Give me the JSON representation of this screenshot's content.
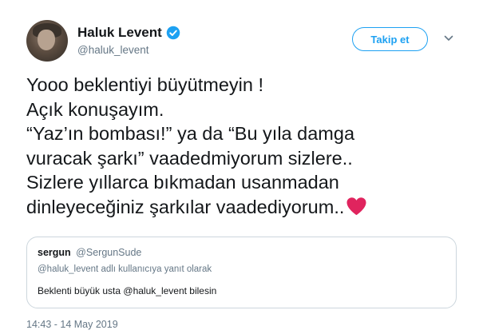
{
  "author": {
    "display_name": "Haluk Levent",
    "handle": "@haluk_levent",
    "verified": true,
    "avatar_icon": "profile-photo"
  },
  "actions": {
    "follow_label": "Takip et",
    "more_icon": "chevron-down-icon"
  },
  "tweet": {
    "lines": [
      "Yooo beklentiyi büyütmeyin !",
      "Açık konuşayım.",
      "“Yaz’ın bombası!” ya da “Bu yıla damga",
      "vuracak şarkı” vaadedmiyorum sizlere..",
      "Sizlere yıllarca bıkmadan usanmadan",
      "dinleyeceğiniz şarkılar vaadediyorum.."
    ],
    "emoji": "heart-icon",
    "heart_color": "#e0245e"
  },
  "quote": {
    "name": "sergun",
    "handle": "@SergunSude",
    "reply_context": "@haluk_levent adlı kullanıcıya yanıt olarak",
    "text": "Beklenti büyük usta @haluk_levent bilesin"
  },
  "timestamp": "14:43 - 14 May 2019",
  "colors": {
    "accent": "#1da1f2",
    "secondary_text": "#657786",
    "border": "#ccd6dd"
  }
}
